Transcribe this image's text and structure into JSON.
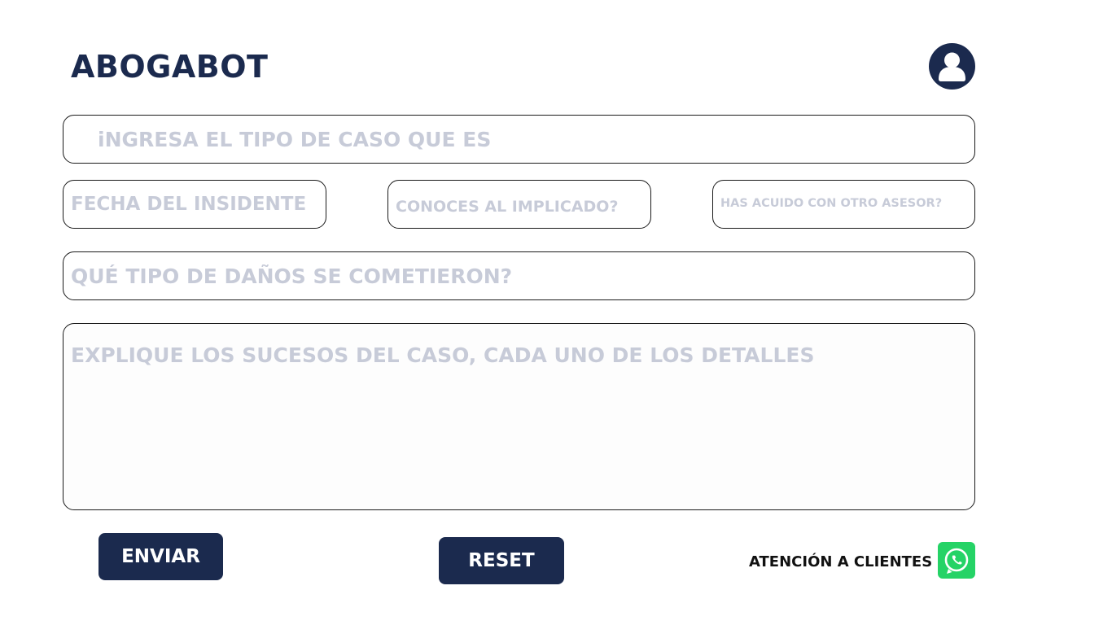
{
  "header": {
    "brand": "ABOGABOT",
    "profile_icon": "user-avatar-icon"
  },
  "form": {
    "case_type": {
      "placeholder": "iNGRESA EL TIPO DE CASO QUE ES",
      "value": ""
    },
    "incident_date": {
      "placeholder": "FECHA DEL INSIDENTE",
      "value": ""
    },
    "know_involved": {
      "placeholder": "CONOCES AL IMPLICADO?",
      "value": ""
    },
    "other_advisor": {
      "placeholder": "HAS ACUIDO CON OTRO ASESOR?",
      "value": ""
    },
    "damages": {
      "placeholder": "QUÉ TIPO DE DAÑOS SE COMETIERON?",
      "value": ""
    },
    "details": {
      "placeholder": "EXPLIQUE LOS SUCESOS DEL CASO, CADA UNO DE LOS DETALLES",
      "value": ""
    }
  },
  "actions": {
    "send_label": "ENVIAR",
    "reset_label": "RESET"
  },
  "support": {
    "label": "ATENCIÓN A CLIENTES",
    "icon": "whatsapp-icon"
  },
  "colors": {
    "brand_navy": "#1b2a4e",
    "placeholder_gray": "#c7cbd8",
    "whatsapp_green": "#25d366"
  }
}
